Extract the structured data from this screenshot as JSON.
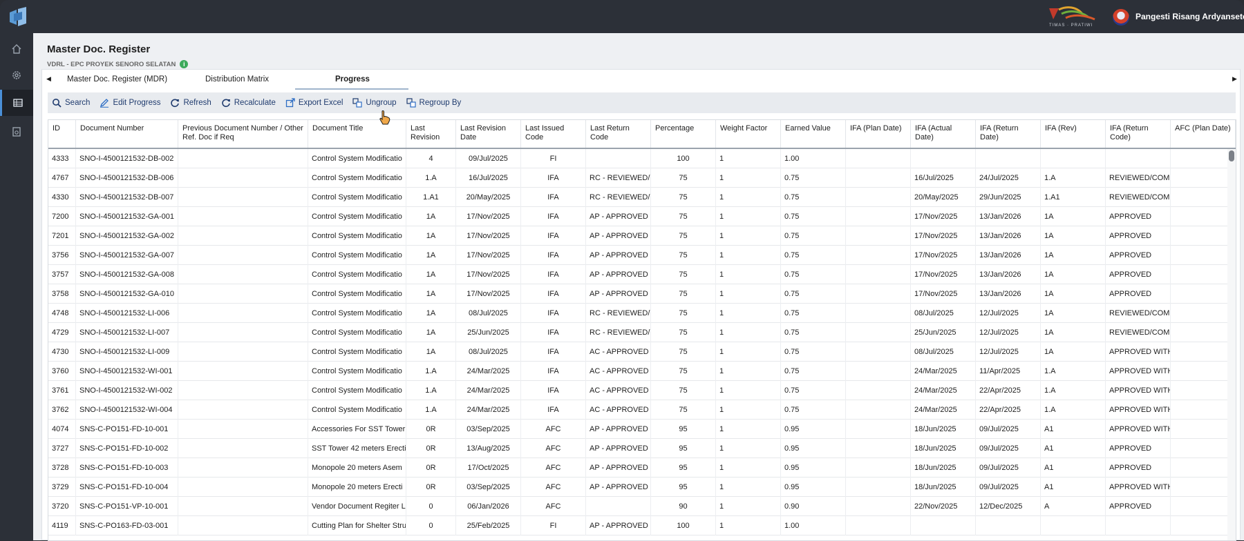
{
  "app": {
    "user_name": "Pangesti Risang Ardyanseto",
    "partner_logo_text": "TIMAS · PRATIWI",
    "accent": "#4a8fd8"
  },
  "nav": {
    "items": [
      {
        "icon": "home-icon"
      },
      {
        "icon": "gear-icon"
      },
      {
        "icon": "grid-table-icon",
        "active": true
      },
      {
        "icon": "document-settings-icon"
      }
    ]
  },
  "page": {
    "title": "Master Doc. Register",
    "subtitle": "VDRL - EPC PROYEK SENORO SELATAN"
  },
  "tabs": {
    "left_arrow": "◀",
    "right_arrow": "▶",
    "items": [
      "Master Doc. Register (MDR)",
      "Distribution Matrix",
      "Progress"
    ],
    "active_index": 2
  },
  "toolbar": {
    "search": "Search",
    "edit_progress": "Edit Progress",
    "refresh": "Refresh",
    "recalculate": "Recalculate",
    "export_excel": "Export Excel",
    "ungroup": "Ungroup",
    "regroup_by": "Regroup By"
  },
  "table": {
    "columns": [
      "ID",
      "Document Number",
      "Previous Document Number / Other Ref. Doc if Req",
      "Document Title",
      "Last Revision",
      "Last Revision Date",
      "Last Issued Code",
      "Last Return Code",
      "Percentage",
      "Weight Factor",
      "Earned Value",
      "IFA (Plan Date)",
      "IFA (Actual Date)",
      "IFA (Return Date)",
      "IFA (Rev)",
      "IFA (Return Code)",
      "AFC (Plan Date)"
    ],
    "rows": [
      [
        "4333",
        "SNO-I-4500121532-DB-002",
        "",
        "Control System Modificatio",
        "4",
        "09/Jul/2025",
        "FI",
        "",
        "100",
        "1",
        "1.00",
        "",
        "",
        "",
        "",
        "",
        ""
      ],
      [
        "4767",
        "SNO-I-4500121532-DB-006",
        "",
        "Control System Modificatio",
        "1.A",
        "16/Jul/2025",
        "IFA",
        "RC - REVIEWED/C",
        "75",
        "1",
        "0.75",
        "",
        "16/Jul/2025",
        "24/Jul/2025",
        "1.A",
        "REVIEWED/COMM",
        ""
      ],
      [
        "4330",
        "SNO-I-4500121532-DB-007",
        "",
        "Control System Modificatio",
        "1.A1",
        "20/May/2025",
        "IFA",
        "RC - REVIEWED/C",
        "75",
        "1",
        "0.75",
        "",
        "20/May/2025",
        "29/Jun/2025",
        "1.A1",
        "REVIEWED/COMM",
        ""
      ],
      [
        "7200",
        "SNO-I-4500121532-GA-001",
        "",
        "Control System Modificatio",
        "1A",
        "17/Nov/2025",
        "IFA",
        "AP - APPROVED",
        "75",
        "1",
        "0.75",
        "",
        "17/Nov/2025",
        "13/Jan/2026",
        "1A",
        "APPROVED",
        ""
      ],
      [
        "7201",
        "SNO-I-4500121532-GA-002",
        "",
        "Control System Modificatio",
        "1A",
        "17/Nov/2025",
        "IFA",
        "AP - APPROVED",
        "75",
        "1",
        "0.75",
        "",
        "17/Nov/2025",
        "13/Jan/2026",
        "1A",
        "APPROVED",
        ""
      ],
      [
        "3756",
        "SNO-I-4500121532-GA-007",
        "",
        "Control System Modificatio",
        "1A",
        "17/Nov/2025",
        "IFA",
        "AP - APPROVED",
        "75",
        "1",
        "0.75",
        "",
        "17/Nov/2025",
        "13/Jan/2026",
        "1A",
        "APPROVED",
        ""
      ],
      [
        "3757",
        "SNO-I-4500121532-GA-008",
        "",
        "Control System Modificatio",
        "1A",
        "17/Nov/2025",
        "IFA",
        "AP - APPROVED",
        "75",
        "1",
        "0.75",
        "",
        "17/Nov/2025",
        "13/Jan/2026",
        "1A",
        "APPROVED",
        ""
      ],
      [
        "3758",
        "SNO-I-4500121532-GA-010",
        "",
        "Control System Modificatio",
        "1A",
        "17/Nov/2025",
        "IFA",
        "AP - APPROVED",
        "75",
        "1",
        "0.75",
        "",
        "17/Nov/2025",
        "13/Jan/2026",
        "1A",
        "APPROVED",
        ""
      ],
      [
        "4748",
        "SNO-I-4500121532-LI-006",
        "",
        "Control System Modificatio",
        "1A",
        "08/Jul/2025",
        "IFA",
        "RC - REVIEWED/C",
        "75",
        "1",
        "0.75",
        "",
        "08/Jul/2025",
        "12/Jul/2025",
        "1A",
        "REVIEWED/COMM",
        ""
      ],
      [
        "4729",
        "SNO-I-4500121532-LI-007",
        "",
        "Control System Modificatio",
        "1A",
        "25/Jun/2025",
        "IFA",
        "RC - REVIEWED/C",
        "75",
        "1",
        "0.75",
        "",
        "25/Jun/2025",
        "12/Jul/2025",
        "1A",
        "REVIEWED/COMM",
        ""
      ],
      [
        "4730",
        "SNO-I-4500121532-LI-009",
        "",
        "Control System Modificatio",
        "1A",
        "08/Jul/2025",
        "IFA",
        "AC - APPROVED W",
        "75",
        "1",
        "0.75",
        "",
        "08/Jul/2025",
        "12/Jul/2025",
        "1A",
        "APPROVED WITH",
        ""
      ],
      [
        "3760",
        "SNO-I-4500121532-WI-001",
        "",
        "Control System Modificatio",
        "1.A",
        "24/Mar/2025",
        "IFA",
        "AC - APPROVED W",
        "75",
        "1",
        "0.75",
        "",
        "24/Mar/2025",
        "11/Apr/2025",
        "1.A",
        "APPROVED WITH",
        ""
      ],
      [
        "3761",
        "SNO-I-4500121532-WI-002",
        "",
        "Control System Modificatio",
        "1.A",
        "24/Mar/2025",
        "IFA",
        "AC - APPROVED W",
        "75",
        "1",
        "0.75",
        "",
        "24/Mar/2025",
        "22/Apr/2025",
        "1.A",
        "APPROVED WITH",
        ""
      ],
      [
        "3762",
        "SNO-I-4500121532-WI-004",
        "",
        "Control System Modificatio",
        "1.A",
        "24/Mar/2025",
        "IFA",
        "AC - APPROVED W",
        "75",
        "1",
        "0.75",
        "",
        "24/Mar/2025",
        "22/Apr/2025",
        "1.A",
        "APPROVED WITH",
        ""
      ],
      [
        "4074",
        "SNS-C-PO151-FD-10-001",
        "",
        "Accessories For SST Tower",
        "0R",
        "03/Sep/2025",
        "AFC",
        "AP - APPROVED",
        "95",
        "1",
        "0.95",
        "",
        "18/Jun/2025",
        "09/Jul/2025",
        "A1",
        "APPROVED WITH",
        ""
      ],
      [
        "3727",
        "SNS-C-PO151-FD-10-002",
        "",
        "SST Tower 42 meters Erecti",
        "0R",
        "13/Aug/2025",
        "AFC",
        "AP - APPROVED",
        "95",
        "1",
        "0.95",
        "",
        "18/Jun/2025",
        "09/Jul/2025",
        "A1",
        "APPROVED",
        ""
      ],
      [
        "3728",
        "SNS-C-PO151-FD-10-003",
        "",
        "Monopole 20 meters Asem",
        "0R",
        "17/Oct/2025",
        "AFC",
        "AP - APPROVED",
        "95",
        "1",
        "0.95",
        "",
        "18/Jun/2025",
        "09/Jul/2025",
        "A1",
        "APPROVED",
        ""
      ],
      [
        "3729",
        "SNS-C-PO151-FD-10-004",
        "",
        "Monopole 20 meters Erecti",
        "0R",
        "03/Sep/2025",
        "AFC",
        "AP - APPROVED",
        "95",
        "1",
        "0.95",
        "",
        "18/Jun/2025",
        "09/Jul/2025",
        "A1",
        "APPROVED WITH",
        ""
      ],
      [
        "3720",
        "SNS-C-PO151-VP-10-001",
        "",
        "Vendor Document Regiter L",
        "0",
        "06/Jan/2026",
        "AFC",
        "",
        "90",
        "1",
        "0.90",
        "",
        "22/Nov/2025",
        "12/Dec/2025",
        "A",
        "APPROVED",
        ""
      ],
      [
        "4119",
        "SNS-C-PO163-FD-03-001",
        "",
        "Cutting Plan for Shelter Stru",
        "0",
        "25/Feb/2025",
        "FI",
        "AP - APPROVED",
        "100",
        "1",
        "1.00",
        "",
        "",
        "",
        "",
        "",
        ""
      ]
    ]
  }
}
